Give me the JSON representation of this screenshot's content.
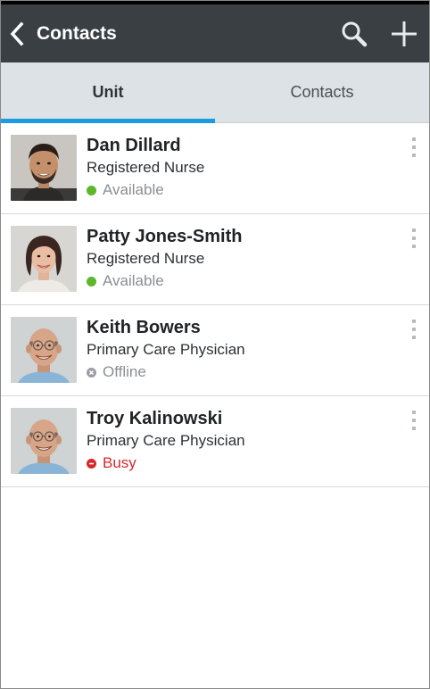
{
  "header": {
    "title": "Contacts"
  },
  "tabs": [
    {
      "label": "Unit",
      "active": true
    },
    {
      "label": "Contacts",
      "active": false
    }
  ],
  "contacts": [
    {
      "name": "Dan Dillard",
      "role": "Registered Nurse",
      "status": "Available",
      "status_color": "#5cb82a",
      "status_text_color": "#8a8f93",
      "status_kind": "available"
    },
    {
      "name": "Patty Jones-Smith",
      "role": "Registered Nurse",
      "status": "Available",
      "status_color": "#5cb82a",
      "status_text_color": "#8a8f93",
      "status_kind": "available"
    },
    {
      "name": "Keith Bowers",
      "role": "Primary Care Physician",
      "status": "Offline",
      "status_color": "#9a9ea2",
      "status_text_color": "#8a8f93",
      "status_kind": "offline"
    },
    {
      "name": "Troy Kalinowski",
      "role": "Primary Care Physician",
      "status": "Busy",
      "status_color": "#d6282b",
      "status_text_color": "#d6282b",
      "status_kind": "busy"
    }
  ],
  "colors": {
    "actionbar": "#3a3f44",
    "tab_bg": "#dde2e6",
    "tab_indicator": "#1c9be0"
  },
  "icons": {
    "back": "chevron-left-icon",
    "search": "search-icon",
    "add": "plus-icon",
    "overflow": "overflow-menu-icon"
  }
}
